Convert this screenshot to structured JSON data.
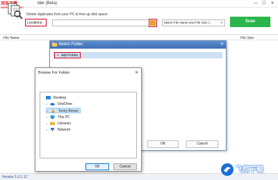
{
  "watermark": {
    "top_text": "河东下载",
    "url": "www.FXXZ.com",
    "logo_text": "飞翔下载"
  },
  "window": {
    "title": "lder (Beta)",
    "controls": [
      "—",
      "☐",
      "✕"
    ]
  },
  "toolbar": {
    "description": "Delete duplicates from your PC to free up disk space",
    "locations_label": "Locations:",
    "path_value": "",
    "match_option": "Match File Name and File Size (...",
    "scan_label": "Scan"
  },
  "list": {
    "columns": [
      "File Name",
      "File Size"
    ]
  },
  "status": {
    "version": "Version 1.0.1.12"
  },
  "select_dialog": {
    "title": "Select Folder",
    "add_folder_label": "Add Folder",
    "ok_label": "OK",
    "cancel_label": "Cancel"
  },
  "browse_dialog": {
    "title": "Browse For Folder",
    "ok_label": "OK",
    "cancel_label": "Cancel",
    "tree": [
      {
        "label": "Desktop",
        "icon": "desktop-icon",
        "expandable": false,
        "selected": false
      },
      {
        "label": "OneDrive",
        "icon": "cloud-icon",
        "expandable": true,
        "selected": false
      },
      {
        "label": "Tonny Brown",
        "icon": "user-icon",
        "expandable": true,
        "selected": true
      },
      {
        "label": "This PC",
        "icon": "computer-icon",
        "expandable": true,
        "selected": false
      },
      {
        "label": "Libraries",
        "icon": "library-icon",
        "expandable": true,
        "selected": false
      },
      {
        "label": "Network",
        "icon": "network-icon",
        "expandable": true,
        "selected": false
      }
    ]
  },
  "colors": {
    "scan_green": "#2bb54a",
    "highlight_red": "#d0021b",
    "dialog_title_blue": "#3f6fb5",
    "version_blue": "#2e4f8f",
    "watermark_red": "#e60012"
  }
}
